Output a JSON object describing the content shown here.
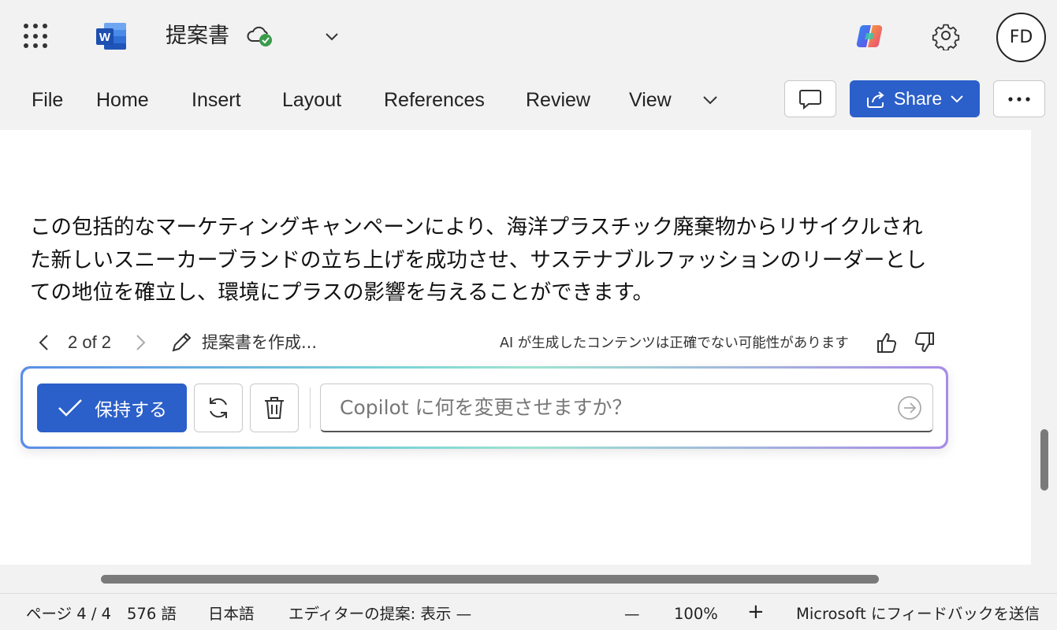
{
  "header": {
    "doc_title": "提案書",
    "avatar_initials": "FD",
    "app_icon": "word-icon",
    "sync_icon": "cloud-saved-icon"
  },
  "ribbon": {
    "tabs": [
      "File",
      "Home",
      "Insert",
      "Layout",
      "References",
      "Review",
      "View"
    ],
    "share_label": "Share"
  },
  "document": {
    "lines": [
      "この包括的なマーケティングキャンペーンにより、海洋プラスチック廃棄物からリサイクルされ",
      "た新しいスニーカーブランドの立ち上げを成功させ、サステナブルファッションのリーダーとし",
      "ての地位を確立し、環境にプラスの影響を与えることができます。"
    ]
  },
  "copilot": {
    "page_count": "2 of 2",
    "prompt_label": "提案書を作成...",
    "disclaimer": "AI が生成したコンテンツは正確でない可能性があります",
    "keep_label": "保持する",
    "input_placeholder": "Copilot に何を変更させますか？"
  },
  "status_bar": {
    "page": "ページ 4 / 4",
    "words": "576 語",
    "language": "日本語",
    "editor": "エディターの提案: 表示 —",
    "zoom_out": "—",
    "zoom": "100%",
    "zoom_in": "+",
    "feedback": "Microsoft にフィードバックを送信"
  },
  "colors": {
    "accent": "#2b5fc9",
    "selection": "#e7eefb",
    "background": "#f2f2f2"
  }
}
